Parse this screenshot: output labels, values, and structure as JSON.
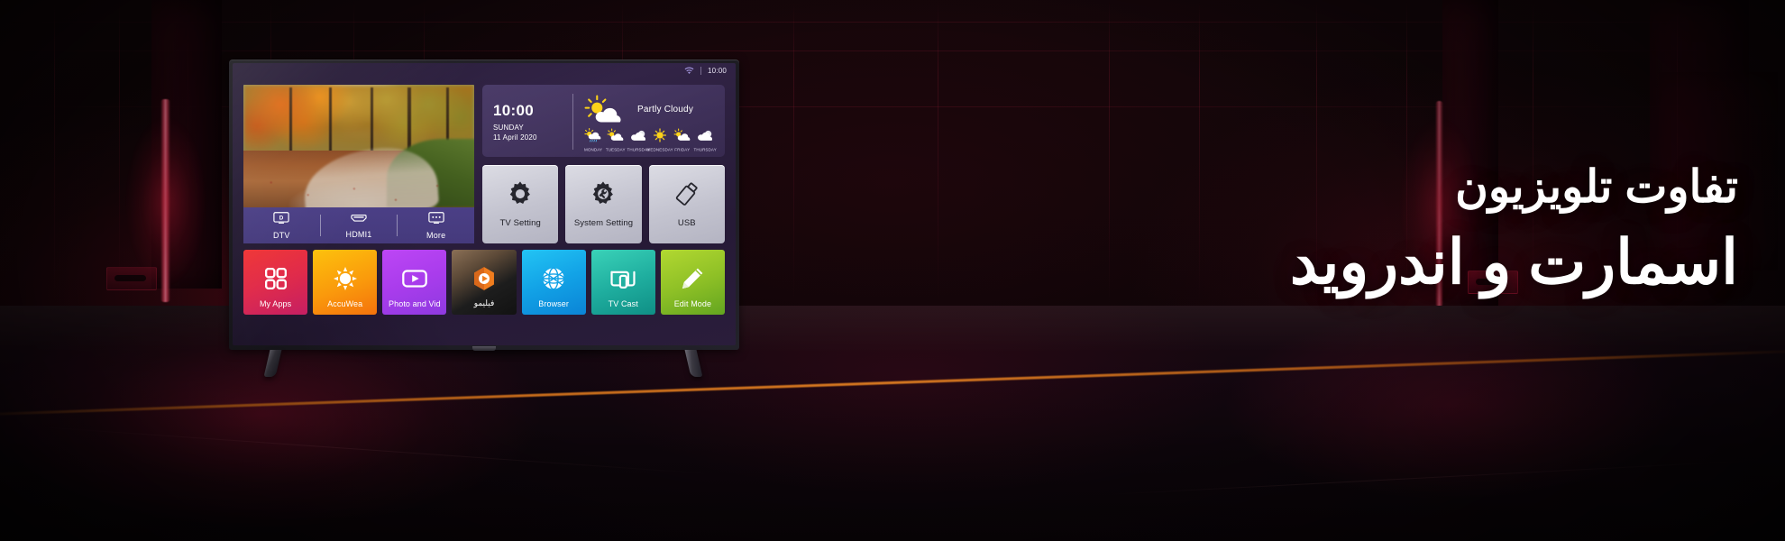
{
  "scene": {
    "headline": {
      "line1": "تفاوت تلویزیون",
      "line2": "اسمارت و اندروید"
    },
    "accent_color": "#e01b3c",
    "neon_color": "#ff5a78",
    "floor_line_color": "#d67018"
  },
  "tv": {
    "statusbar": {
      "wifi_icon": "wifi-icon",
      "time": "10:00"
    },
    "preview": {
      "label": "autumn-forest-path-preview"
    },
    "sources": [
      {
        "icon": "dtv-icon",
        "label": "DTV"
      },
      {
        "icon": "hdmi-icon",
        "label": "HDMI1"
      },
      {
        "icon": "more-icon",
        "label": "More"
      }
    ],
    "weather": {
      "time": "10:00",
      "day": "SUNDAY",
      "date": "11 April 2020",
      "condition": "Partly Cloudy",
      "condition_icon": "sun-behind-cloud-icon",
      "forecast": [
        {
          "day": "MONDAY",
          "icon": "sun-cloud-rain-icon"
        },
        {
          "day": "TUESDAY",
          "icon": "sun-behind-cloud-icon"
        },
        {
          "day": "THURSDAY",
          "icon": "cloudy-icon"
        },
        {
          "day": "WEDNESDAY",
          "icon": "sunny-icon"
        },
        {
          "day": "FRIDAY",
          "icon": "sun-behind-cloud-icon"
        },
        {
          "day": "THURSDAY",
          "icon": "cloudy-icon"
        }
      ]
    },
    "settings": [
      {
        "icon": "gear-icon",
        "label": "TV Setting"
      },
      {
        "icon": "gear-wrench-icon",
        "label": "System Setting"
      },
      {
        "icon": "usb-drive-icon",
        "label": "USB"
      }
    ],
    "apps": [
      {
        "icon": "grid-apps-icon",
        "label": "My Apps",
        "color_from": "#ef3434",
        "color_to": "#c51f63"
      },
      {
        "icon": "sun-icon",
        "label": "AccuWea",
        "color_from": "#fdc10d",
        "color_to": "#f4720c"
      },
      {
        "icon": "video-play-icon",
        "label": "Photo and Vid",
        "color_from": "#b43cf0",
        "color_to": "#8e3ae0"
      },
      {
        "icon": "filimo-icon",
        "label": "فیلیمو",
        "color_from": "#7b6650",
        "color_to": "#171717"
      },
      {
        "icon": "browser-icon",
        "label": "Browser",
        "color_from": "#18bdf0",
        "color_to": "#0b84d6"
      },
      {
        "icon": "tv-cast-icon",
        "label": "TV Cast",
        "color_from": "#2ec4b0",
        "color_to": "#0f8f85"
      },
      {
        "icon": "pencil-icon",
        "label": "Edit Mode",
        "color_from": "#a8d02c",
        "color_to": "#63a520"
      }
    ]
  }
}
